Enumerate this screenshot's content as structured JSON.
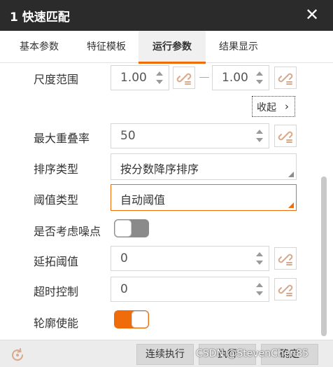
{
  "window": {
    "title": "1 快速匹配",
    "close_glyph": "✕"
  },
  "tabs": [
    {
      "label": "基本参数"
    },
    {
      "label": "特征模板"
    },
    {
      "label": "运行参数"
    },
    {
      "label": "结果显示"
    }
  ],
  "fields": {
    "scale_range": {
      "label": "尺度范围",
      "min": "1.00",
      "max": "1.00"
    },
    "collapse": {
      "label": "收起",
      "chevron": "›"
    },
    "max_overlap": {
      "label": "最大重叠率",
      "value": "50"
    },
    "sort_type": {
      "label": "排序类型",
      "value": "按分数降序排序"
    },
    "threshold_type": {
      "label": "阈值类型",
      "value": "自动阈值"
    },
    "consider_noise": {
      "label": "是否考虑噪点",
      "enabled": false
    },
    "extend_threshold": {
      "label": "延拓阈值",
      "value": "0"
    },
    "timeout_control": {
      "label": "超时控制",
      "value": "0"
    },
    "contour_enable": {
      "label": "轮廓使能",
      "enabled": true
    }
  },
  "footer": {
    "continuous_run": "连续执行",
    "run": "执行",
    "confirm": "确定"
  },
  "watermark": "CSDN @StevenChen85",
  "colors": {
    "accent": "#f06b0a",
    "titlebar": "#2b2b2b",
    "link_icon": "#d9a98c"
  },
  "icons": {
    "link": "link-icon",
    "refresh": "refresh-icon",
    "close": "close-icon"
  }
}
